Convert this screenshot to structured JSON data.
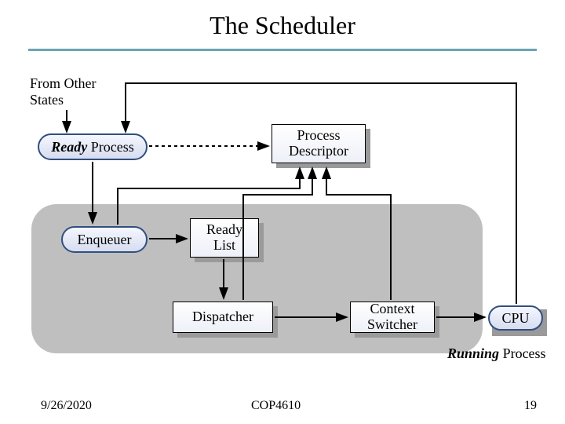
{
  "title": "The Scheduler",
  "labels": {
    "from_other_l1": "From Other",
    "from_other_l2": "States",
    "ready_process_italic": "Ready",
    "ready_process_rest": " Process",
    "process_descriptor_l1": "Process",
    "process_descriptor_l2": "Descriptor",
    "enqueuer": "Enqueuer",
    "ready_list_l1": "Ready",
    "ready_list_l2": "List",
    "dispatcher": "Dispatcher",
    "context_switcher_l1": "Context",
    "context_switcher_l2": "Switcher",
    "cpu": "CPU",
    "running_process_italic": "Running",
    "running_process_rest": " Process"
  },
  "footer": {
    "date": "9/26/2020",
    "course": "COP4610",
    "page": "19"
  }
}
